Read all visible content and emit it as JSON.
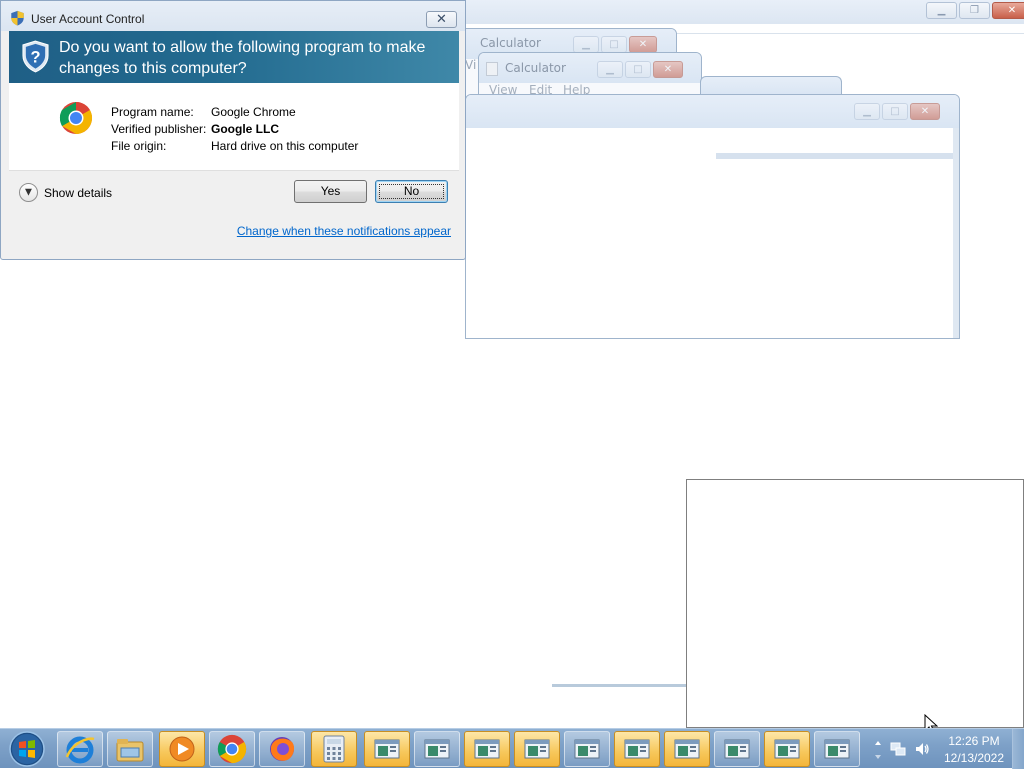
{
  "uac": {
    "title": "User Account Control",
    "question": "Do you want to allow the following program to make changes to this computer?",
    "program_name_label": "Program name:",
    "program_name": "Google Chrome",
    "publisher_label": "Verified publisher:",
    "publisher": "Google LLC",
    "origin_label": "File origin:",
    "origin": "Hard drive on this computer",
    "show_details": "Show details",
    "yes": "Yes",
    "no": "No",
    "notifications_link": "Change when these notifications appear",
    "close_glyph": "✕"
  },
  "background_windows": {
    "calculator_1_title": "Calculator",
    "calculator_2_title": "Calculator",
    "calculator_2_menu": [
      "View",
      "Edit",
      "Help"
    ],
    "partial_menu": "Vi"
  },
  "taskbar": {
    "pinned": [
      "internet-explorer-icon",
      "windows-explorer-icon",
      "windows-media-player-icon",
      "google-chrome-icon",
      "firefox-icon",
      "calculator-icon"
    ],
    "window_buttons": 10,
    "time": "12:26 PM",
    "date": "12/13/2022"
  },
  "colors": {
    "uac_banner": "#226a8f",
    "taskbar": "#7ea1c8",
    "link": "#0066cc"
  }
}
